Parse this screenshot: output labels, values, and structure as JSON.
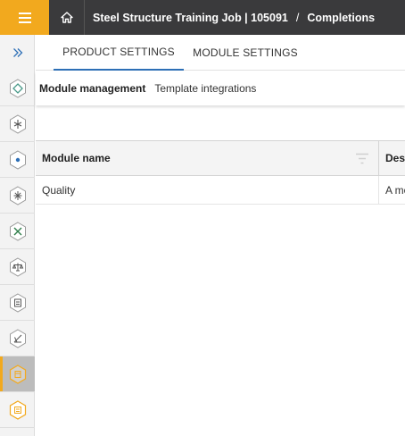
{
  "header": {
    "project": "Steel Structure Training Job | 105091",
    "separator": "/",
    "page": "Completions"
  },
  "tabs": [
    {
      "label": "PRODUCT SETTINGS",
      "active": true
    },
    {
      "label": "MODULE SETTINGS",
      "active": false
    }
  ],
  "subnav": {
    "items": [
      {
        "label": "Module management",
        "selected": true
      },
      {
        "label": "Template integrations",
        "selected": false
      }
    ]
  },
  "table": {
    "columns": [
      "Module name",
      "Description"
    ],
    "rows": [
      {
        "module_name": "Quality",
        "description": "A module"
      }
    ]
  },
  "sidebar": {
    "items": [
      {
        "icon": "expand-icon"
      },
      {
        "icon": "module-hex-icon-1",
        "color": "#4a9a8a"
      },
      {
        "icon": "module-hex-icon-2",
        "color": "#555555"
      },
      {
        "icon": "module-hex-icon-3",
        "color": "#2d6fb6"
      },
      {
        "icon": "module-hex-icon-4",
        "color": "#555555"
      },
      {
        "icon": "module-hex-icon-5",
        "color": "#2f7d4a"
      },
      {
        "icon": "module-hex-icon-6",
        "color": "#555555"
      },
      {
        "icon": "module-hex-icon-7",
        "color": "#555555"
      },
      {
        "icon": "module-hex-icon-8",
        "color": "#555555"
      },
      {
        "icon": "module-hex-icon-9",
        "color": "#f2a91e",
        "active": true
      },
      {
        "icon": "module-hex-icon-10",
        "color": "#f2a91e"
      }
    ]
  },
  "colors": {
    "accent": "#f2a91e",
    "topbar": "#3a3a3c",
    "tab_underline": "#2d6fb6"
  }
}
